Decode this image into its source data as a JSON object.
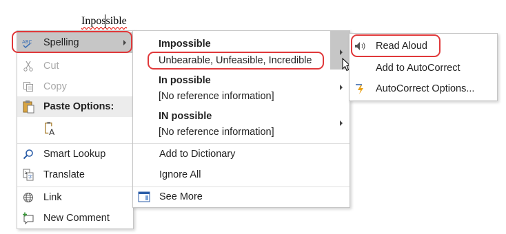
{
  "document": {
    "word": "Inpossible"
  },
  "menu1": {
    "spelling": "Spelling",
    "cut": "Cut",
    "copy": "Copy",
    "paste_options": "Paste Options:",
    "smart_lookup": "Smart Lookup",
    "translate": "Translate",
    "link": "Link",
    "new_comment": "New Comment"
  },
  "menu2": {
    "suggestions": [
      {
        "word": "Impossible",
        "meaning": "Unbearable, Unfeasible, Incredible"
      },
      {
        "word": "In possible",
        "meaning": "[No reference information]"
      },
      {
        "word": "IN possible",
        "meaning": "[No reference information]"
      }
    ],
    "add_to_dictionary": "Add to Dictionary",
    "ignore_all": "Ignore All",
    "see_more": "See More"
  },
  "menu3": {
    "read_aloud": "Read Aloud",
    "add_to_autocorrect": "Add to AutoCorrect",
    "autocorrect_options": "AutoCorrect Options..."
  },
  "colors": {
    "highlight": "#c6c6c6",
    "callout": "#e0383a",
    "squiggle": "#e8312b"
  }
}
